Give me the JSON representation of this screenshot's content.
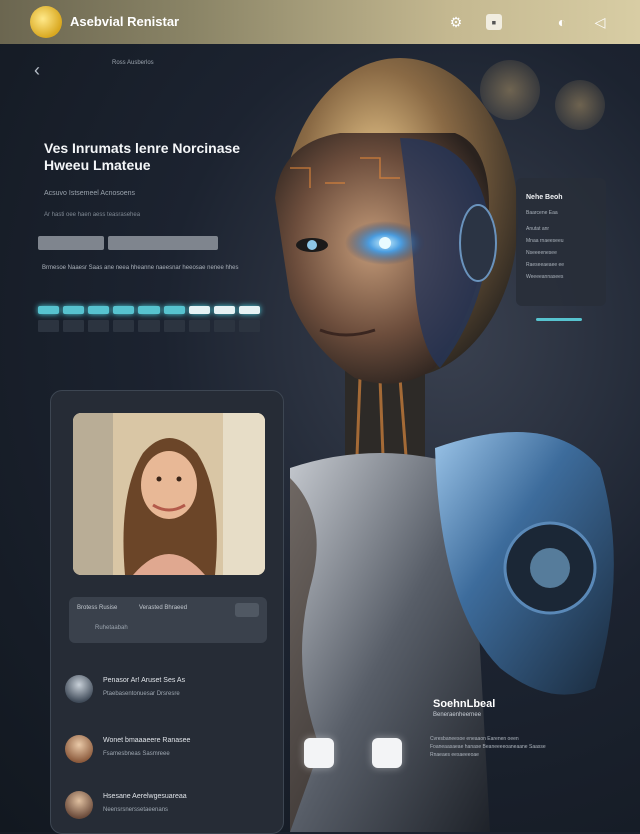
{
  "topbar": {
    "app_title": "Asebvial Renistar",
    "icons": [
      "settings-icon",
      "document-icon",
      "globe-icon",
      "send-icon"
    ]
  },
  "left_panel": {
    "header_label": "Ross Ausberlos",
    "headline": "Ves Inrumats lenre Norcinase Hweeu Lmateue",
    "sub1": "Acsuvo Istsemeel Acnosoens",
    "sub2": "Ar hasti oee haen aess teasrasehea",
    "body_text": "Brmesoe Naaesr Saas ane neea hheanne naeesnar heeosae nenee hhes",
    "progress_segments": 9,
    "progress_white_start": 6
  },
  "phone": {
    "info": {
      "l1": "Brotess Rusise",
      "l2": "Verasted Bhraeed",
      "l3": "Ruhetaabah"
    },
    "chats": [
      {
        "name": "Penasor Ar! Aruset Ses As",
        "msg": "Ptaebasentonuesar Drsresre"
      },
      {
        "name": "Wonet bmaaaeere Ranasee",
        "msg": "Fsamesbneas Sasmreee"
      },
      {
        "name": "Hsesane Aerelwgesuareaa",
        "msg": "Neensrsnerssetaeenans"
      }
    ]
  },
  "right_card": {
    "title": "Nehe Beoh",
    "lines": [
      "Baarcene Eaa",
      "Anutat anr",
      "Mnaa rnaeeseeu",
      "Nseeeenesee",
      "Raeseeaeaee ee",
      "Weeeeannasees"
    ]
  },
  "robot_caption": {
    "title": "SoehnLbeal",
    "sub": "Beneraenheernee",
    "body": "Cvresbaneesoe eneaaon Earenen oeen Foaneaasaeae hanase Beaneeeeoaneaane Saasse Rnaeaes eesaeeeoae"
  },
  "colors": {
    "accent": "#57c3cf",
    "topbar_start": "#6b6650",
    "topbar_end": "#d8cda4"
  }
}
